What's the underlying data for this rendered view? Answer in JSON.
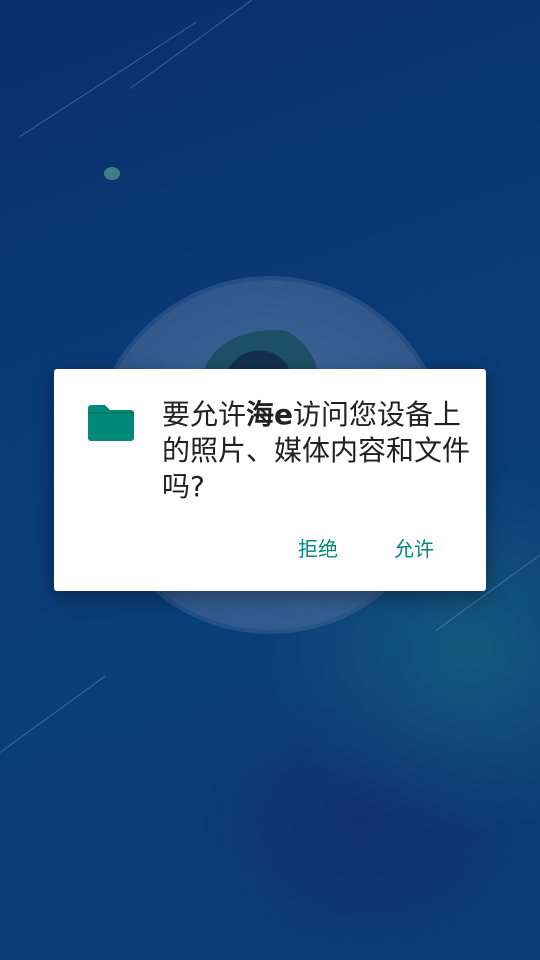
{
  "dialog": {
    "message_before": "要允许",
    "app_name": "海e",
    "message_after": "访问您设备上的照片、媒体内容和文件吗?",
    "deny_label": "拒绝",
    "allow_label": "允许"
  },
  "colors": {
    "accent": "#00897b",
    "dialog_bg": "#ffffff",
    "background": "#0a3b76"
  },
  "icons": {
    "permission": "folder-icon"
  }
}
